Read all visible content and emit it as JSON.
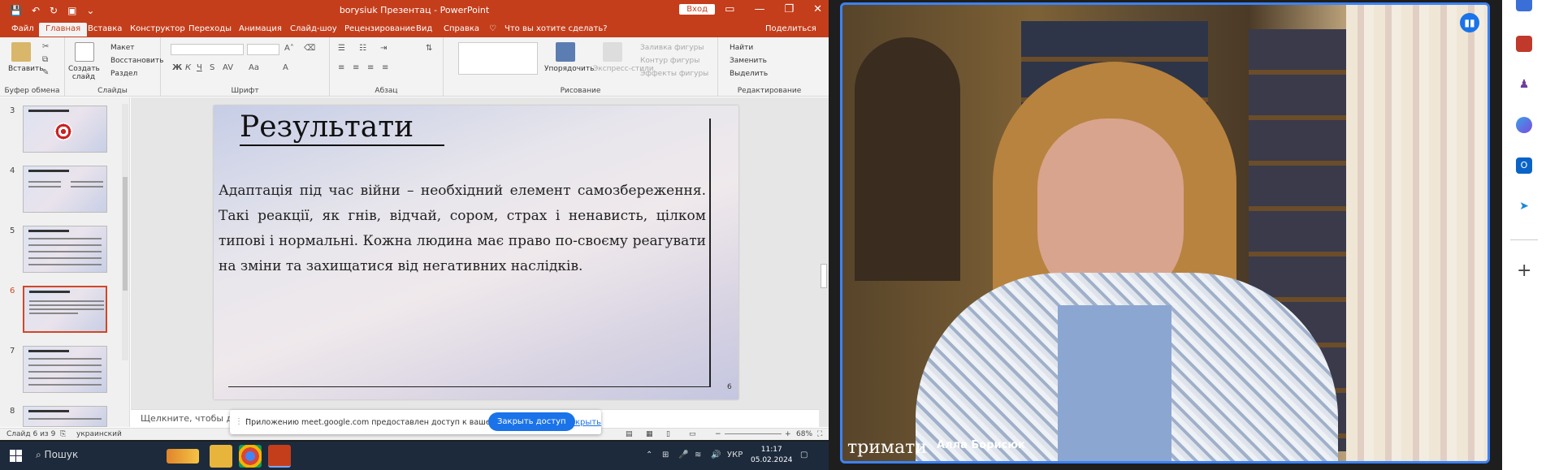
{
  "window": {
    "title": "borysiuk Презентац  -  PowerPoint",
    "signin": "Вход",
    "controls": [
      "▭",
      "—",
      "❐",
      "✕"
    ]
  },
  "quick_access": [
    "💾",
    "↶",
    "↻",
    "▣",
    "⌄"
  ],
  "menu": {
    "items": [
      "Файл",
      "Главная",
      "Вставка",
      "Конструктор",
      "Переходы",
      "Анимация",
      "Слайд-шоу",
      "Рецензирование",
      "Вид",
      "Справка"
    ],
    "search": "Что вы хотите сделать?",
    "share": "Поделиться"
  },
  "ribbon": {
    "clipboard": {
      "label": "Буфер обмена",
      "paste": "Вставить"
    },
    "slides": {
      "label": "Слайды",
      "new_slide": "Создать слайд",
      "layout": "Макет",
      "reset": "Восстановить",
      "section": "Раздел"
    },
    "font": {
      "label": "Шрифт"
    },
    "paragraph": {
      "label": "Абзац"
    },
    "drawing": {
      "label": "Рисование",
      "arrange": "Упорядочить",
      "quick_styles": "Экспресс-стили",
      "fill": "Заливка фигуры",
      "outline": "Контур фигуры",
      "effects": "Эффекты фигуры"
    },
    "editing": {
      "label": "Редактирование",
      "find": "Найти",
      "replace": "Заменить",
      "select": "Выделить"
    }
  },
  "thumbnails": [
    {
      "num": "3"
    },
    {
      "num": "4"
    },
    {
      "num": "5"
    },
    {
      "num": "6"
    },
    {
      "num": "7"
    },
    {
      "num": "8"
    }
  ],
  "slide": {
    "title": "Результати",
    "body": "Адаптація під час війни – необхідний елемент самозбереження. Такі реакції, як гнів, відчай, сором, страх і ненависть, цілком типові і нормальні. Кожна людина має право по-своєму реагувати на зміни та захищатися від негативних наслідків.",
    "page": "6"
  },
  "notes_placeholder": "Щелкните, чтобы доба",
  "share_banner": {
    "message": "Приложению meet.google.com предоставлен доступ к вашему экрану.",
    "stop": "Закрыть доступ",
    "hide": "Скрыть"
  },
  "status": {
    "slide": "Слайд 6 из 9",
    "lang": "украинский",
    "zoom": "68%"
  },
  "taskbar": {
    "search": "Пошук",
    "lang": "УКР",
    "time": "11:17",
    "date": "05.02.2024"
  },
  "video": {
    "caption": "тримати",
    "name": "Алла Борисюк"
  },
  "colors": {
    "ppt_accent": "#c43e1c",
    "meet_blue": "#1a73e8",
    "video_border": "#3b82f6"
  }
}
